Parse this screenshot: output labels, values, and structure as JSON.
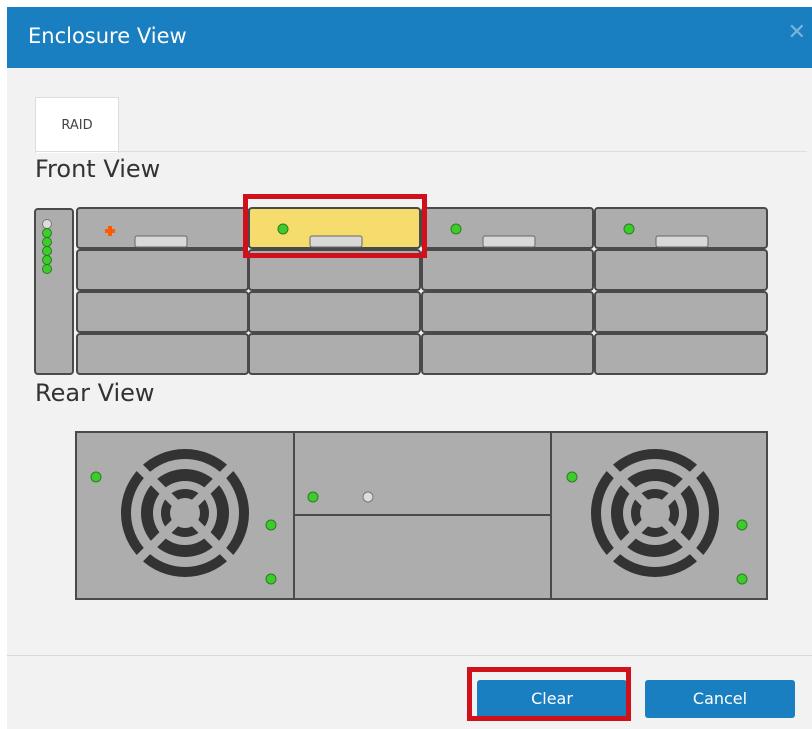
{
  "dialog": {
    "title": "Enclosure View",
    "close_icon": "close-icon"
  },
  "tabs": [
    {
      "label": "RAID",
      "active": true
    }
  ],
  "front": {
    "heading": "Front View"
  },
  "rear": {
    "heading": "Rear View"
  },
  "footer": {
    "clear_label": "Clear",
    "cancel_label": "Cancel"
  },
  "colors": {
    "accent": "#1a7fc0",
    "highlight": "#d0101a",
    "selected_drive": "#f5dc6c",
    "led_green": "#3ecb2c",
    "fault": "#ff5a00"
  }
}
